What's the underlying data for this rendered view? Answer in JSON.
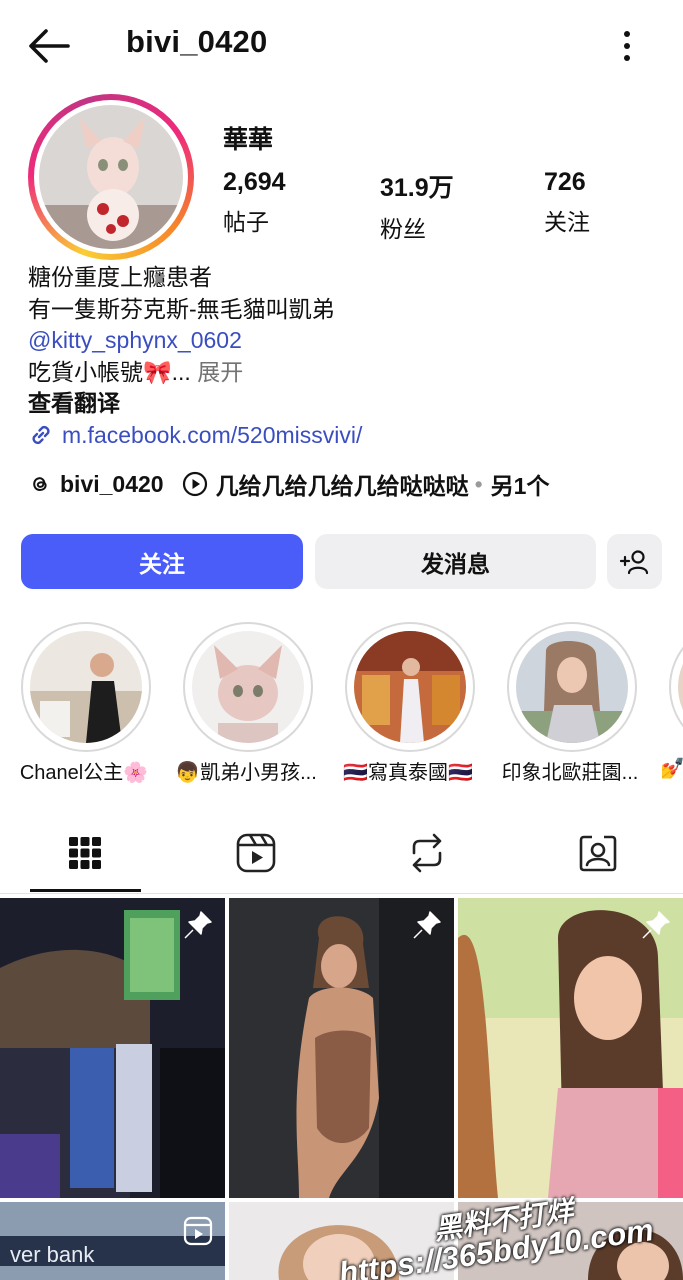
{
  "header": {
    "username": "bivi_0420",
    "back_icon": "arrow-left-icon",
    "more_icon": "kebab-vertical-icon"
  },
  "profile": {
    "display_name": "華華",
    "stats": [
      {
        "value": "2,694",
        "label": "帖子"
      },
      {
        "value": "31.9万",
        "label": "粉丝"
      },
      {
        "value": "726",
        "label": "关注"
      }
    ],
    "bio_lines": [
      "糖份重度上癮患者",
      "有一隻斯芬克斯-無毛貓叫凱弟"
    ],
    "mention": "@kitty_sphynx_0602",
    "last_line": "吃貨小帳號🎀...",
    "more_label": "展开",
    "translate_label": "查看翻译",
    "link": "m.facebook.com/520missvivi/",
    "threads_handle": "bivi_0420",
    "music_text": "几给几给几给几给哒哒哒",
    "more_count": "另1个"
  },
  "actions": {
    "follow": "关注",
    "message": "发消息"
  },
  "highlights": [
    {
      "label": "Chanel公主🌸",
      "color_a": "#e8e3dc",
      "color_b": "#2a2a2a"
    },
    {
      "label": "👦凱弟小男孩...",
      "color_a": "#f0ecec",
      "color_b": "#d8b9b5"
    },
    {
      "label": "🇹🇭寫真泰國🇹🇭",
      "color_a": "#c46a3b",
      "color_b": "#e9e4ea"
    },
    {
      "label": "印象北歐莊園...",
      "color_a": "#cfd4da",
      "color_b": "#8aa07a"
    },
    {
      "label": "💅",
      "color_a": "#e8d4c7",
      "color_b": "#c69a8e"
    }
  ],
  "tabs": [
    {
      "name": "tab-grid",
      "icon": "grid-icon"
    },
    {
      "name": "tab-reels",
      "icon": "reels-icon"
    },
    {
      "name": "tab-reposts",
      "icon": "repost-icon"
    },
    {
      "name": "tab-tagged",
      "icon": "tagged-person-icon"
    }
  ],
  "colors": {
    "accent": "#4a5df9",
    "link": "#3b4ec0",
    "secondary_button": "#efeff1"
  },
  "watermark": {
    "line1": "黑料不打烊",
    "line2": "https://365bdy10.com"
  }
}
